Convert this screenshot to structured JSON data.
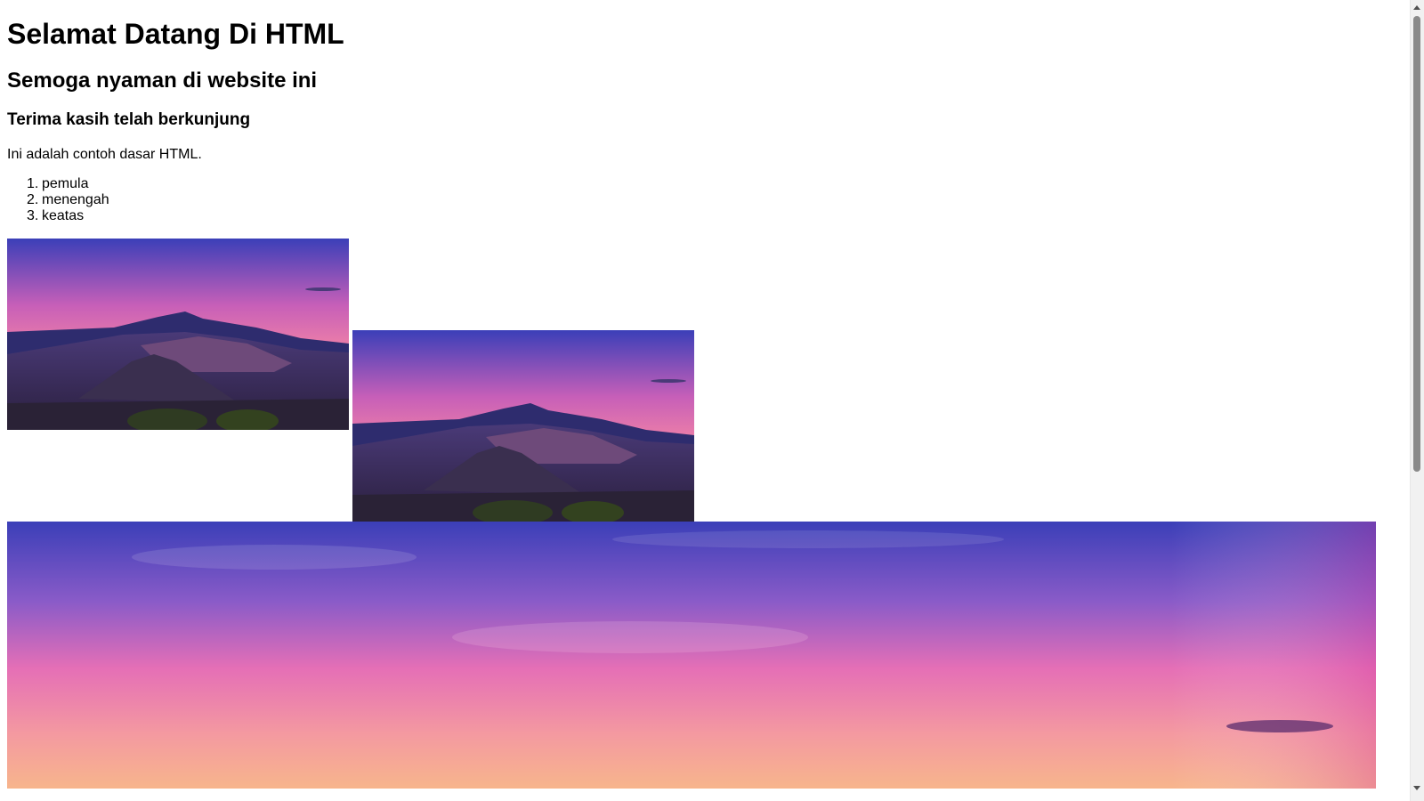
{
  "headings": {
    "h1": "Selamat Datang Di HTML",
    "h2": "Semoga nyaman di website ini",
    "h3": "Terima kasih telah berkunjung"
  },
  "paragraph": "Ini adalah contoh dasar HTML.",
  "list": {
    "items": [
      {
        "num": "1.",
        "label": "pemula"
      },
      {
        "num": "2.",
        "label": "menengah"
      },
      {
        "num": "3.",
        "label": "keatas"
      }
    ]
  },
  "images": [
    {
      "icon": "volcano-landscape-image"
    },
    {
      "icon": "volcano-landscape-image"
    },
    {
      "icon": "sunset-sky-image"
    }
  ],
  "colors": {
    "sky_top": "#3b3fb8",
    "sky_mid": "#e96ab0",
    "sky_low": "#f6a07a",
    "mountain": "#2a2350",
    "background": "#ffffff"
  }
}
